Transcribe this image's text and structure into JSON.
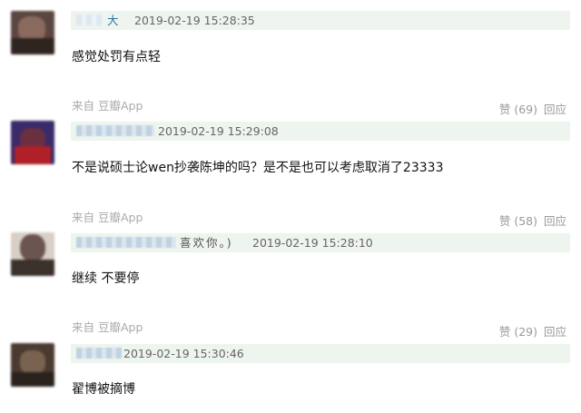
{
  "comments": [
    {
      "author_visible": "大",
      "time": "2019-02-19 15:28:35",
      "content": "感觉处罚有点轻",
      "source": "来自 豆瓣App",
      "like_label": "赞 (69)",
      "reply_label": "回应"
    },
    {
      "author_visible": "",
      "time": "2019-02-19 15:29:08",
      "content": "不是说硕士论wen抄袭陈坤的吗？是不是也可以考虑取消了23333",
      "source": "来自 豆瓣App",
      "like_label": "赞 (58)",
      "reply_label": "回应"
    },
    {
      "author_visible": "喜欢你。)",
      "time": "2019-02-19 15:28:10",
      "content": "继续 不要停",
      "source": "来自 豆瓣App",
      "like_label": "赞 (29)",
      "reply_label": "回应"
    },
    {
      "author_visible": "",
      "time": "2019-02-19 15:30:46",
      "content": "翟博被摘博"
    }
  ],
  "colors": {
    "meta_bar": "#eef4ee",
    "author_link": "#3377aa",
    "muted": "#999999",
    "source": "#aaaaaa"
  }
}
